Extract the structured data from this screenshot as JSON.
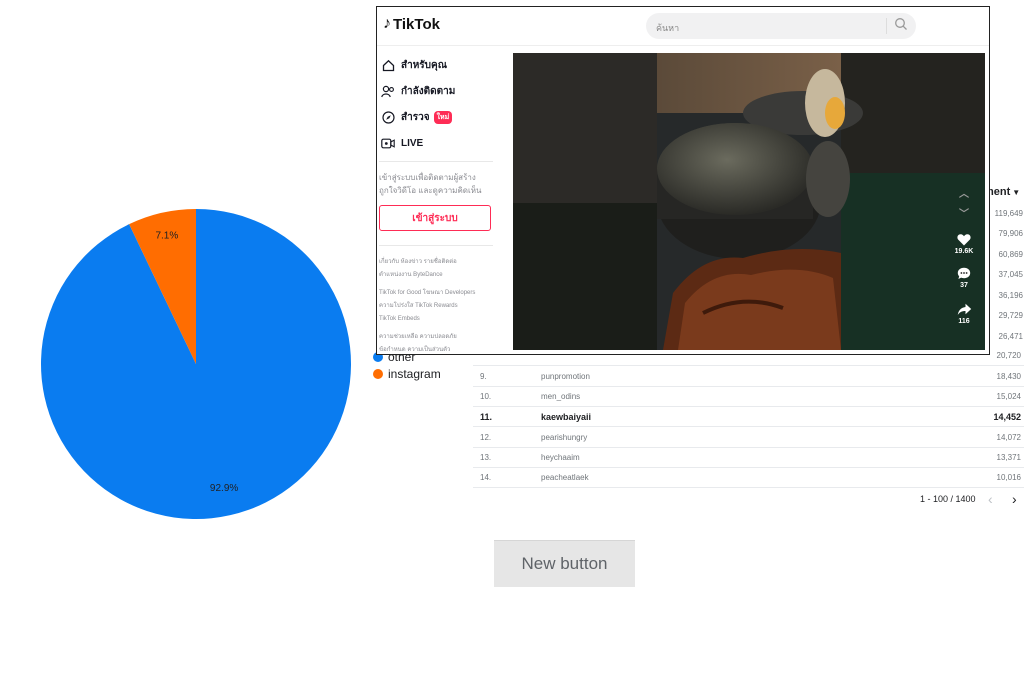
{
  "chart_data": {
    "type": "pie",
    "slices": [
      {
        "name": "other",
        "value": 92.9,
        "label": "92.9%",
        "color": "#0a7cf0"
      },
      {
        "name": "instagram",
        "value": 7.1,
        "label": "7.1%",
        "color": "#ff6d01"
      }
    ],
    "legend": [
      "other",
      "instagram"
    ],
    "legend_position": "right"
  },
  "table": {
    "header_partial": "ment",
    "right_values_partial": [
      "119,649",
      "79,906",
      "60,869",
      "37,045",
      "36,196",
      "29,729",
      "26,471"
    ],
    "rows": [
      {
        "idx": "",
        "name": "",
        "value": "20,720"
      },
      {
        "idx": "9.",
        "name": "punpromotion",
        "value": "18,430"
      },
      {
        "idx": "10.",
        "name": "men_odins",
        "value": "15,024"
      },
      {
        "idx": "11.",
        "name": "kaewbaiyaii",
        "value": "14,452",
        "bold": true
      },
      {
        "idx": "12.",
        "name": "pearishungry",
        "value": "14,072"
      },
      {
        "idx": "13.",
        "name": "heychaaim",
        "value": "13,371"
      },
      {
        "idx": "14.",
        "name": "peacheatlaek",
        "value": "10,016"
      }
    ],
    "pagination": "1 - 100 / 1400"
  },
  "button": {
    "label": "New button"
  },
  "tiktok": {
    "logo": "TikTok",
    "search_placeholder": "ค้นหา",
    "nav": [
      {
        "label": "สำหรับคุณ",
        "icon": "home-icon"
      },
      {
        "label": "กำลังติดตาม",
        "icon": "following-icon"
      },
      {
        "label": "สำรวจ",
        "icon": "compass-icon",
        "badge": "ใหม่"
      },
      {
        "label": "LIVE",
        "icon": "live-icon"
      }
    ],
    "login_hint": "เข้าสู่ระบบเพื่อติดตามผู้สร้าง ถูกใจวิดีโอ และดูความคิดเห็น",
    "login_button": "เข้าสู่ระบบ",
    "footer_lines": [
      "เกี่ยวกับ ห้องข่าว รายชื่อติดต่อ",
      "ตำแหน่งงาน ByteDance",
      "TikTok for Good โฆษณา Developers",
      "ความโปร่งใส TikTok Rewards",
      "TikTok Embeds",
      "ความช่วยเหลือ ความปลอดภัย",
      "ข้อกำหนด ความเป็นส่วนตัว"
    ],
    "likes": "19.6K",
    "comments": "37",
    "shares": "116"
  }
}
